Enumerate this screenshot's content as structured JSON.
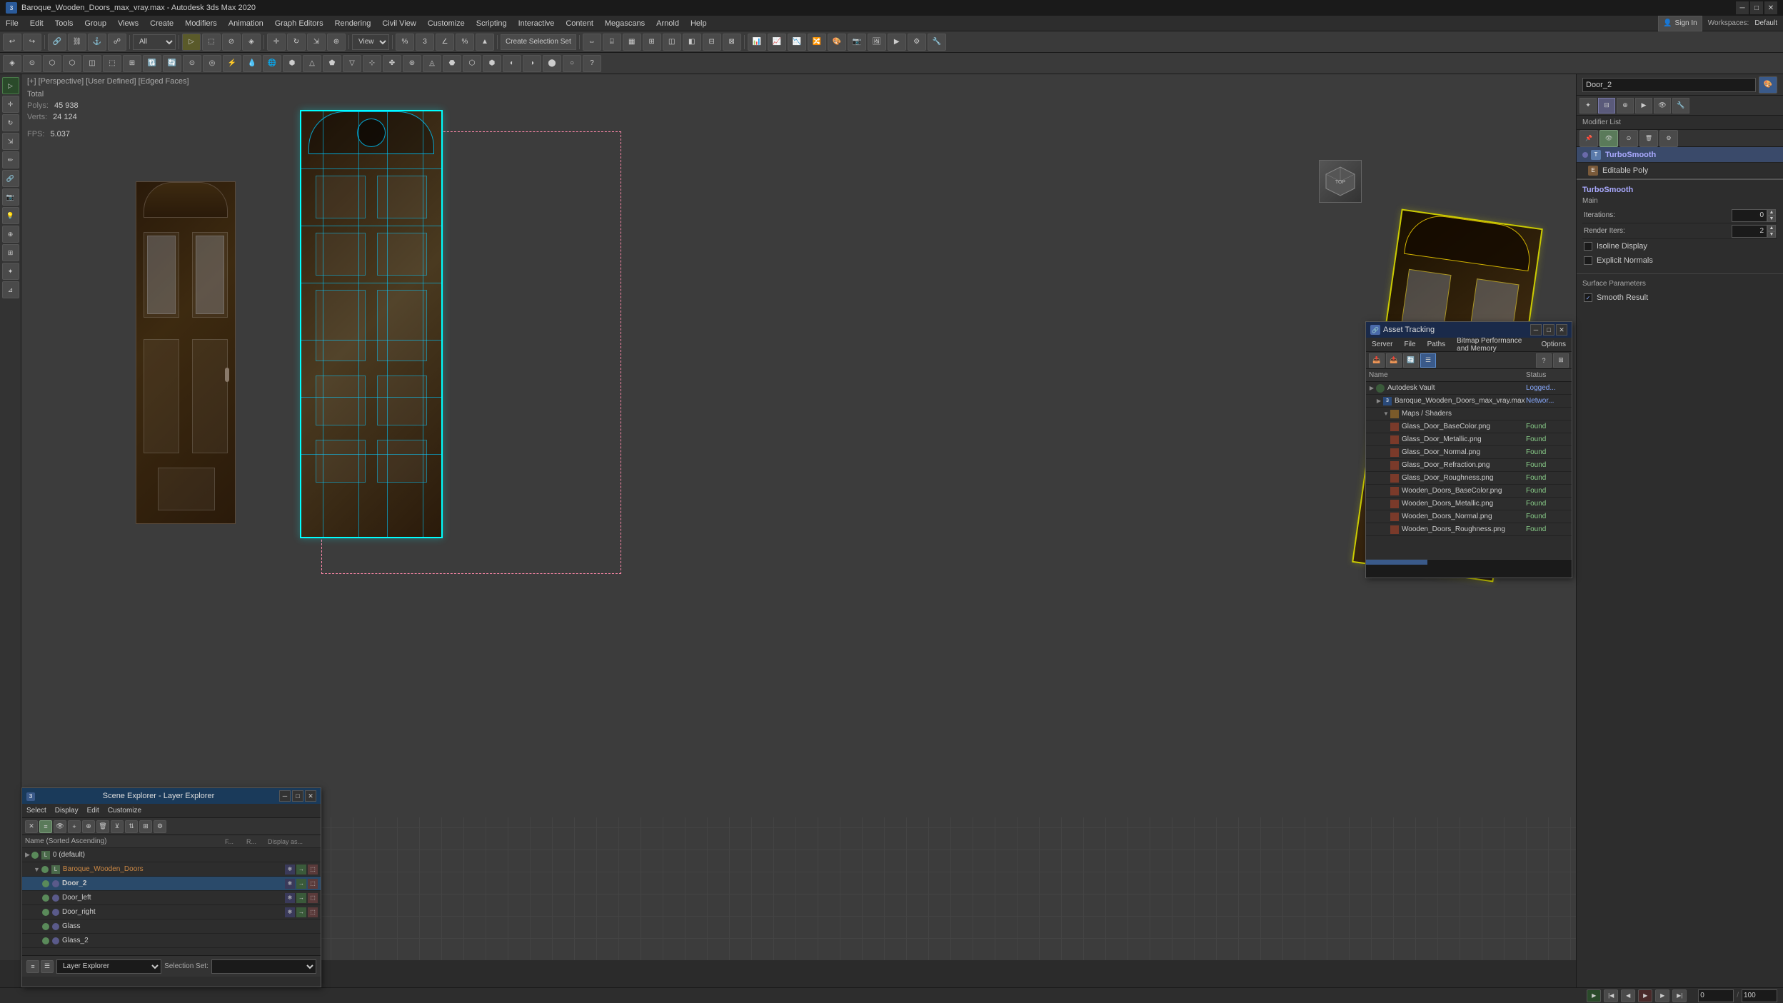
{
  "app": {
    "title": "Baroque_Wooden_Doors_max_vray.max - Autodesk 3ds Max 2020",
    "icon_text": "3"
  },
  "titlebar": {
    "minimize": "─",
    "maximize": "□",
    "close": "✕"
  },
  "menubar": {
    "items": [
      {
        "label": "File"
      },
      {
        "label": "Edit"
      },
      {
        "label": "Tools"
      },
      {
        "label": "Group"
      },
      {
        "label": "Views"
      },
      {
        "label": "Create"
      },
      {
        "label": "Modifiers"
      },
      {
        "label": "Animation"
      },
      {
        "label": "Graph Editors"
      },
      {
        "label": "Rendering"
      },
      {
        "label": "Civil View"
      },
      {
        "label": "Customize"
      },
      {
        "label": "Scripting"
      },
      {
        "label": "Interactive"
      },
      {
        "label": "Content"
      },
      {
        "label": "Megascans"
      },
      {
        "label": "Arnold"
      },
      {
        "label": "Help"
      }
    ],
    "signin": "Sign In",
    "workspaces_label": "Workspaces:",
    "workspace_value": "Default"
  },
  "toolbar1": {
    "view_dropdown": "View",
    "create_selection_set": "Create Selection Set",
    "snap_dropdown": "3"
  },
  "viewport": {
    "label": "[+] [Perspective] [User Defined] [Edged Faces]",
    "stats": {
      "polys_label": "Polys:",
      "polys_value": "45 938",
      "verts_label": "Verts:",
      "verts_value": "24 124",
      "fps_label": "FPS:",
      "fps_value": "5.037"
    }
  },
  "right_panel": {
    "object_name": "Door_2",
    "modifier_list_label": "Modifier List",
    "modifiers": [
      {
        "name": "TurboSmooth",
        "selected": true
      },
      {
        "name": "Editable Poly",
        "selected": false
      }
    ],
    "turbosmooth": {
      "title": "TurboSmooth",
      "main_label": "Main",
      "iterations_label": "Iterations:",
      "iterations_value": "0",
      "render_iters_label": "Render Iters:",
      "render_iters_value": "2",
      "isoline_display_label": "Isoline Display",
      "explicit_normals_label": "Explicit Normals",
      "surface_params_label": "Surface Parameters",
      "smooth_result_label": "✓ Smooth Result"
    }
  },
  "scene_explorer": {
    "title": "Scene Explorer - Layer Explorer",
    "menus": [
      {
        "label": "Select"
      },
      {
        "label": "Display"
      },
      {
        "label": "Edit"
      },
      {
        "label": "Customize"
      }
    ],
    "columns": {
      "name": "Name (Sorted Ascending)",
      "f": "F...",
      "r": "R...",
      "display": "Display as..."
    },
    "items": [
      {
        "name": "0 (default)",
        "indent": 1,
        "type": "layer",
        "has_children": true
      },
      {
        "name": "Baroque_Wooden_Doors",
        "indent": 2,
        "type": "layer",
        "has_children": true,
        "color": "#cc8844"
      },
      {
        "name": "Door_2",
        "indent": 3,
        "type": "object",
        "selected": true
      },
      {
        "name": "Door_left",
        "indent": 3,
        "type": "object"
      },
      {
        "name": "Door_right",
        "indent": 3,
        "type": "object"
      },
      {
        "name": "Glass",
        "indent": 3,
        "type": "object"
      },
      {
        "name": "Glass_2",
        "indent": 3,
        "type": "object"
      }
    ],
    "bottom": {
      "label": "Layer Explorer",
      "selection_set_label": "Selection Set:"
    }
  },
  "asset_tracking": {
    "title": "Asset Tracking",
    "menus": [
      {
        "label": "Server"
      },
      {
        "label": "File"
      },
      {
        "label": "Paths"
      },
      {
        "label": "Bitmap Performance and Memory"
      },
      {
        "label": "Options"
      }
    ],
    "columns": {
      "name": "Name",
      "status": "Status"
    },
    "items": [
      {
        "name": "Autodesk Vault",
        "indent": 0,
        "type": "vault",
        "status": "Logged...",
        "status_class": "status-logged"
      },
      {
        "name": "Baroque_Wooden_Doors_max_vray.max",
        "indent": 1,
        "type": "max",
        "status": "Networ...",
        "status_class": "status-network"
      },
      {
        "name": "Maps / Shaders",
        "indent": 2,
        "type": "folder",
        "status": "",
        "status_class": ""
      },
      {
        "name": "Glass_Door_BaseColor.png",
        "indent": 3,
        "type": "file",
        "status": "Found",
        "status_class": "status-found"
      },
      {
        "name": "Glass_Door_Metallic.png",
        "indent": 3,
        "type": "file",
        "status": "Found",
        "status_class": "status-found"
      },
      {
        "name": "Glass_Door_Normal.png",
        "indent": 3,
        "type": "file",
        "status": "Found",
        "status_class": "status-found"
      },
      {
        "name": "Glass_Door_Refraction.png",
        "indent": 3,
        "type": "file",
        "status": "Found",
        "status_class": "status-found"
      },
      {
        "name": "Glass_Door_Roughness.png",
        "indent": 3,
        "type": "file",
        "status": "Found",
        "status_class": "status-found"
      },
      {
        "name": "Wooden_Doors_BaseColor.png",
        "indent": 3,
        "type": "file",
        "status": "Found",
        "status_class": "status-found"
      },
      {
        "name": "Wooden_Doors_Metallic.png",
        "indent": 3,
        "type": "file",
        "status": "Found",
        "status_class": "status-found"
      },
      {
        "name": "Wooden_Doors_Normal.png",
        "indent": 3,
        "type": "file",
        "status": "Found",
        "status_class": "status-found"
      },
      {
        "name": "Wooden_Doors_Roughness.png",
        "indent": 3,
        "type": "file",
        "status": "Found",
        "status_class": "status-found"
      }
    ]
  },
  "status_bar": {
    "message": ""
  }
}
